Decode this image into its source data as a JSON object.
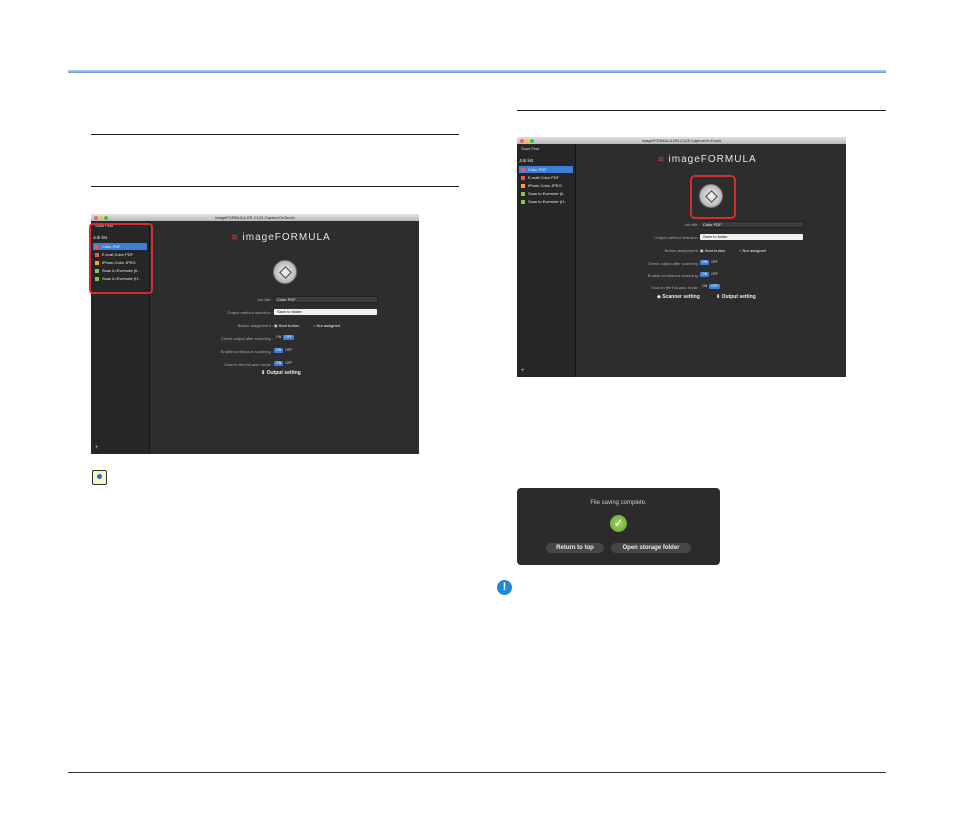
{
  "left_window": {
    "title": "imageFORMULA DR-C125 CaptureOnTouch",
    "scan_first": "Scan First",
    "job_list_label": "Job list",
    "jobs": [
      "Color PDF",
      "E-mail Color PDF",
      "iPhoto Color JPEG",
      "Scan to Evernote (ti..",
      "Scan to Evernote (H.."
    ],
    "logo": "imageFORMULA",
    "job_title_label": "Job title :",
    "job_title_value": "Color PDF",
    "output_method_label": "Output method selection :",
    "output_method_value": "Save to folder",
    "button_assignment_label": "Button assignment :",
    "start_button": "Start button",
    "not_assigned": "Not assigned",
    "check_output_label": "Check output after scanning :",
    "enable_continuous_label": "Enable continuous scanning :",
    "full_auto_label": "Scan in the full-auto mode :",
    "on": "ON",
    "off": "OFF",
    "output_setting": "Output setting",
    "plus": "+"
  },
  "right_window": {
    "title": "imageFORMULA DR-C125 CaptureOnTouch",
    "scan_first": "Scan First",
    "job_list_label": "Job list",
    "jobs": [
      "Color PDF",
      "E-mail Color PDF",
      "iPhoto Color JPEG",
      "Scan to Evernote (ti..",
      "Scan to Evernote (H.."
    ],
    "logo": "imageFORMULA",
    "job_title_label": "Job title :",
    "job_title_value": "Color PDF",
    "output_method_label": "Output method selection :",
    "output_method_value": "Save to folder",
    "button_assignment_label": "Button assignment :",
    "start_button": "Start button",
    "not_assigned": "Not assigned",
    "check_output_label": "Check output after scanning :",
    "enable_continuous_label": "Enable continuous scanning :",
    "full_auto_label": "Scan in the full-auto mode :",
    "on": "ON",
    "off": "OFF",
    "scanner_setting": "Scanner setting",
    "output_setting": "Output setting",
    "plus": "+"
  },
  "dialog": {
    "message": "File saving complete.",
    "return_button": "Return to top",
    "open_button": "Open storage folder"
  },
  "colors": {
    "accent_blue": "#3b7fd6",
    "highlight_red": "#d32f2f",
    "window_bg": "#2d2d2d"
  }
}
